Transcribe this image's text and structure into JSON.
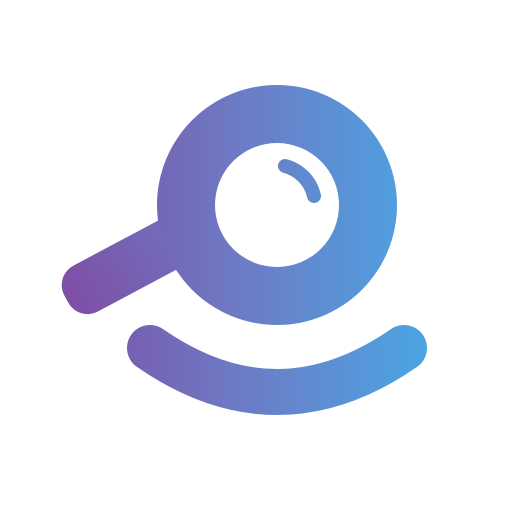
{
  "icon": {
    "name": "magnifier-smile-logo-icon",
    "colors": {
      "gradient_start": "#7E4FA6",
      "gradient_mid": "#6C7CC6",
      "gradient_end": "#4AA6E3",
      "lens_fill": "#ffffff",
      "background": "#ffffff"
    }
  }
}
